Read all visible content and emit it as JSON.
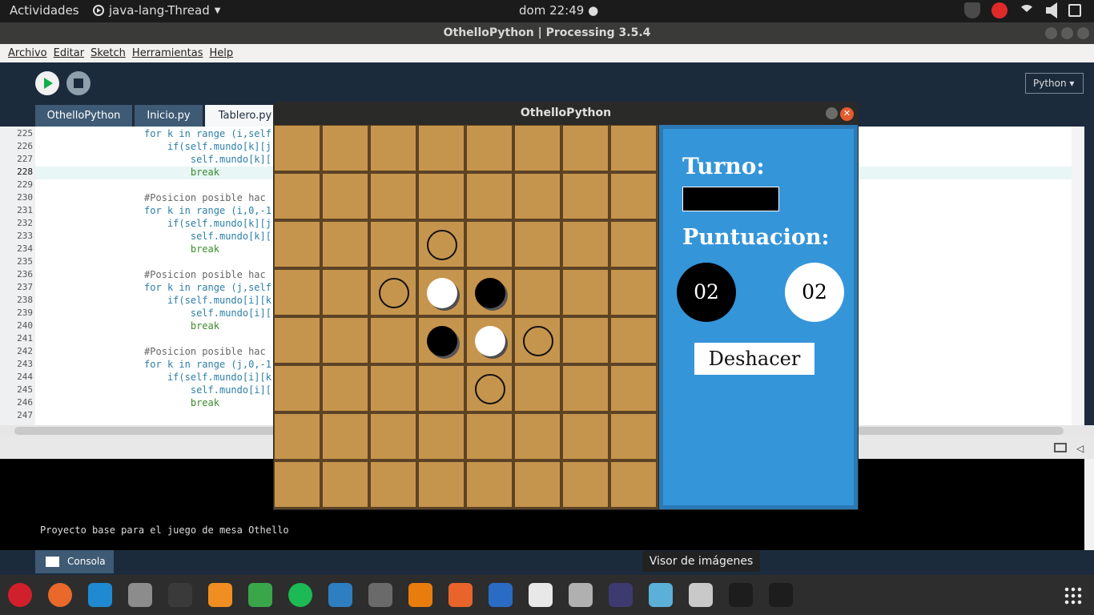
{
  "topbar": {
    "activities": "Actividades",
    "app_name": "java-lang-Thread",
    "clock": "dom 22:49 ●"
  },
  "window": {
    "title": "OthelloPython | Processing 3.5.4"
  },
  "menu": [
    "Archivo",
    "Editar",
    "Sketch",
    "Herramientas",
    "Help"
  ],
  "toolbar": {
    "mode": "Python ▾"
  },
  "tabs": [
    {
      "label": "OthelloPython"
    },
    {
      "label": "Inicio.py"
    },
    {
      "label": "Tablero.py"
    }
  ],
  "editor": {
    "current_line": 228,
    "lines": [
      {
        "n": "225",
        "t": "                  for k in range (i,self"
      },
      {
        "n": "226",
        "t": "                      if(self.mundo[k][j"
      },
      {
        "n": "227",
        "t": "                          self.mundo[k]["
      },
      {
        "n": "228",
        "t": "                          break"
      },
      {
        "n": "229",
        "t": ""
      },
      {
        "n": "230",
        "t": "                  #Posicion posible hac"
      },
      {
        "n": "231",
        "t": "                  for k in range (i,0,-1"
      },
      {
        "n": "232",
        "t": "                      if(self.mundo[k][j"
      },
      {
        "n": "233",
        "t": "                          self.mundo[k]["
      },
      {
        "n": "234",
        "t": "                          break"
      },
      {
        "n": "235",
        "t": ""
      },
      {
        "n": "236",
        "t": "                  #Posicion posible hac"
      },
      {
        "n": "237",
        "t": "                  for k in range (j,self"
      },
      {
        "n": "238",
        "t": "                      if(self.mundo[i][k"
      },
      {
        "n": "239",
        "t": "                          self.mundo[i]["
      },
      {
        "n": "240",
        "t": "                          break"
      },
      {
        "n": "241",
        "t": ""
      },
      {
        "n": "242",
        "t": "                  #Posicion posible hac"
      },
      {
        "n": "243",
        "t": "                  for k in range (j,0,-1"
      },
      {
        "n": "244",
        "t": "                      if(self.mundo[i][k"
      },
      {
        "n": "245",
        "t": "                          self.mundo[i]["
      },
      {
        "n": "246",
        "t": "                          break"
      },
      {
        "n": "247",
        "t": ""
      }
    ]
  },
  "console": {
    "text": "Proyecto base para el juego de mesa Othello",
    "tab_label": "Consola"
  },
  "tooltip": "Visor de imágenes",
  "sketch": {
    "title": "OthelloPython",
    "close_glyph": "✕",
    "board": {
      "size": 8,
      "pieces": [
        {
          "row": 2,
          "col": 3,
          "kind": "hint"
        },
        {
          "row": 3,
          "col": 2,
          "kind": "hint"
        },
        {
          "row": 3,
          "col": 3,
          "kind": "white"
        },
        {
          "row": 3,
          "col": 4,
          "kind": "black"
        },
        {
          "row": 4,
          "col": 3,
          "kind": "black"
        },
        {
          "row": 4,
          "col": 4,
          "kind": "white"
        },
        {
          "row": 4,
          "col": 5,
          "kind": "hint"
        },
        {
          "row": 5,
          "col": 4,
          "kind": "hint"
        }
      ]
    },
    "panel": {
      "turn_label": "Turno:",
      "score_label": "Puntuacion:",
      "score_black": "02",
      "score_white": "02",
      "undo_label": "Deshacer"
    }
  },
  "dock": [
    {
      "icon": "opera-icon",
      "color": "#d0202c"
    },
    {
      "icon": "firefox-icon",
      "color": "#e8692a"
    },
    {
      "icon": "vscode-icon",
      "color": "#1f8ad2"
    },
    {
      "icon": "files-icon",
      "color": "#8c8c8c"
    },
    {
      "icon": "terminal-icon",
      "color": "#3a3a3a"
    },
    {
      "icon": "sublime-icon",
      "color": "#f08e21"
    },
    {
      "icon": "grammarly-icon",
      "color": "#3aa64a"
    },
    {
      "icon": "spotify-icon",
      "color": "#1db954"
    },
    {
      "icon": "dolphin-icon",
      "color": "#2d7fc1"
    },
    {
      "icon": "inkscape-icon",
      "color": "#6a6a6a"
    },
    {
      "icon": "blender-icon",
      "color": "#e87d0d"
    },
    {
      "icon": "software-icon",
      "color": "#e9642b"
    },
    {
      "icon": "writer-icon",
      "color": "#2a6bc4"
    },
    {
      "icon": "pdf-icon",
      "color": "#e8e8e8"
    },
    {
      "icon": "settings-icon",
      "color": "#b0b0b0"
    },
    {
      "icon": "texstudio-icon",
      "color": "#3c3a6e"
    },
    {
      "icon": "virtualbox-icon",
      "color": "#5bb0d8"
    },
    {
      "icon": "image-viewer-icon",
      "color": "#c9c9c9"
    },
    {
      "icon": "processing-icon",
      "color": "#1d1d1d"
    },
    {
      "icon": "processing-run-icon",
      "color": "#1d1d1d"
    }
  ]
}
